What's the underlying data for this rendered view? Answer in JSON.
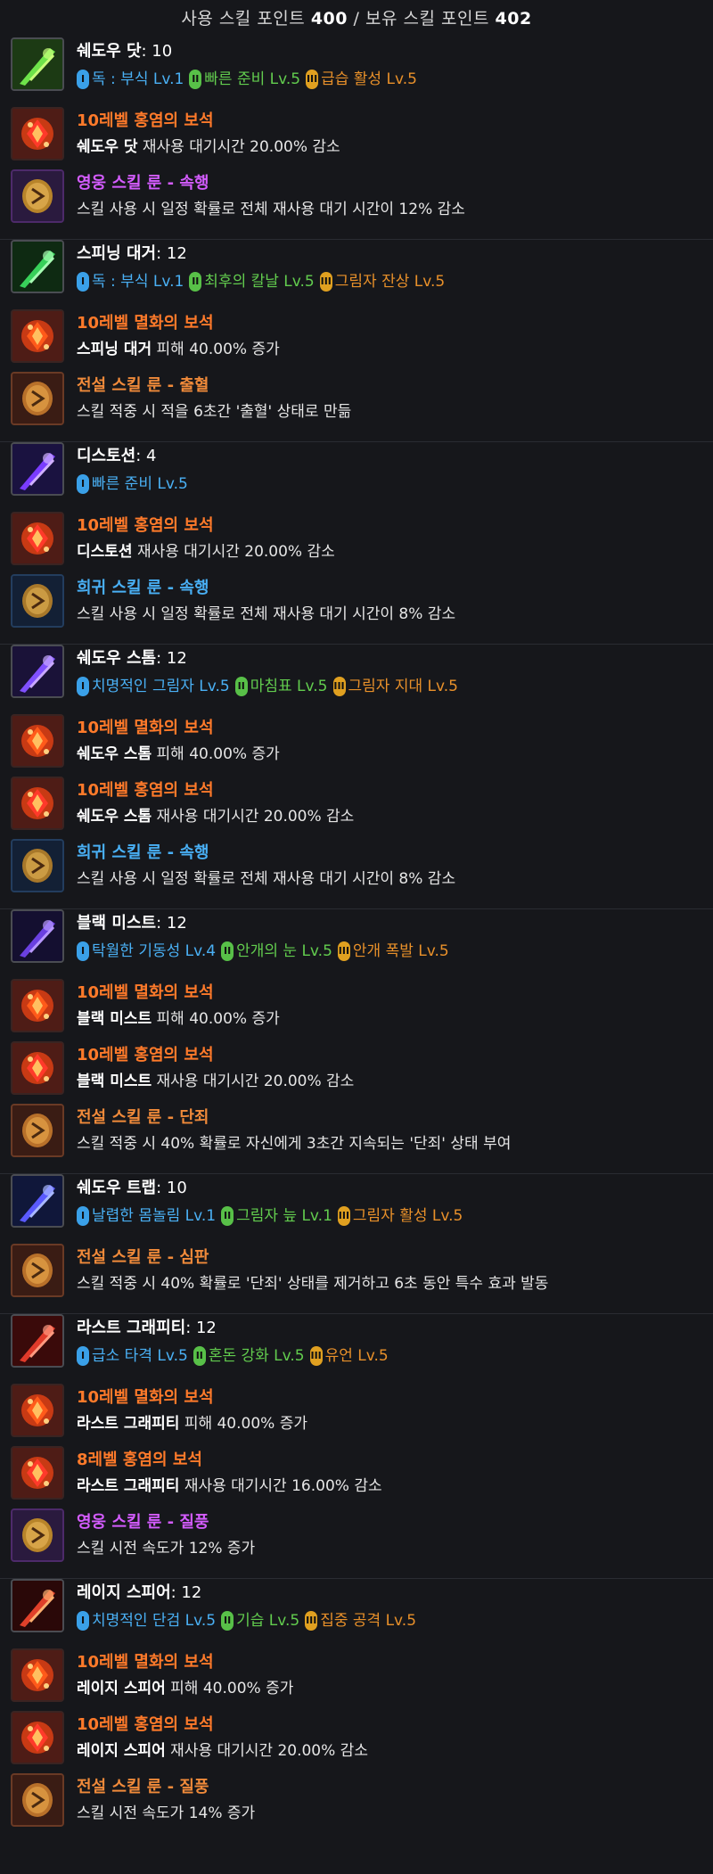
{
  "header": {
    "used_label": "사용 스킬 포인트",
    "used_value": "400",
    "separator": "/",
    "owned_label": "보유 스킬 포인트",
    "owned_value": "402"
  },
  "colors": {
    "gem_title": "#ff7a2a",
    "hero_rune": "#d45cff",
    "rare_rune": "#49b0f5",
    "legend_rune": "#f08a3a",
    "tripod_1": "#4ab0f4",
    "tripod_2": "#62cc4e",
    "tripod_3": "#e8902a"
  },
  "skills": [
    {
      "name": "쉐도우 닷",
      "level": ": 10",
      "icon": "shadow-dot-icon",
      "tripods": [
        "독 : 부식 Lv.1",
        "빠른 준비 Lv.5",
        "급습 활성 Lv.5"
      ],
      "items": [
        {
          "kind": "gem-fire",
          "title": "10레벨 홍염의 보석",
          "skill": "쉐도우 닷",
          "desc": "재사용 대기시간 20.00% 감소"
        },
        {
          "kind": "rune-hero",
          "title": "영웅 스킬 룬 - 속행",
          "skill": "",
          "desc": "스킬 사용 시 일정 확률로 전체 재사용 대기 시간이 12% 감소"
        }
      ]
    },
    {
      "name": "스피닝 대거",
      "level": ": 12",
      "icon": "spinning-dagger-icon",
      "tripods": [
        "독 : 부식 Lv.1",
        "최후의 칼날 Lv.5",
        "그림자 잔상 Lv.5"
      ],
      "items": [
        {
          "kind": "gem-dmg",
          "title": "10레벨 멸화의 보석",
          "skill": "스피닝 대거",
          "desc": "피해 40.00% 증가"
        },
        {
          "kind": "rune-legend",
          "title": "전설 스킬 룬 - 출혈",
          "skill": "",
          "desc": "스킬 적중 시 적을 6초간 '출혈' 상태로 만듦"
        }
      ]
    },
    {
      "name": "디스토션",
      "level": ": 4",
      "icon": "distortion-icon",
      "tripods": [
        "빠른 준비 Lv.5"
      ],
      "items": [
        {
          "kind": "gem-fire",
          "title": "10레벨 홍염의 보석",
          "skill": "디스토션",
          "desc": "재사용 대기시간 20.00% 감소"
        },
        {
          "kind": "rune-rare",
          "title": "희귀 스킬 룬 - 속행",
          "skill": "",
          "desc": "스킬 사용 시 일정 확률로 전체 재사용 대기 시간이 8% 감소"
        }
      ]
    },
    {
      "name": "쉐도우 스톰",
      "level": ": 12",
      "icon": "shadow-storm-icon",
      "tripods": [
        "치명적인 그림자 Lv.5",
        "마침표 Lv.5",
        "그림자 지대 Lv.5"
      ],
      "items": [
        {
          "kind": "gem-dmg",
          "title": "10레벨 멸화의 보석",
          "skill": "쉐도우 스톰",
          "desc": "피해 40.00% 증가"
        },
        {
          "kind": "gem-fire",
          "title": "10레벨 홍염의 보석",
          "skill": "쉐도우 스톰",
          "desc": "재사용 대기시간 20.00% 감소"
        },
        {
          "kind": "rune-rare",
          "title": "희귀 스킬 룬 - 속행",
          "skill": "",
          "desc": "스킬 사용 시 일정 확률로 전체 재사용 대기 시간이 8% 감소"
        }
      ]
    },
    {
      "name": "블랙 미스트",
      "level": ": 12",
      "icon": "black-mist-icon",
      "tripods": [
        "탁월한 기동성 Lv.4",
        "안개의 눈 Lv.5",
        "안개 폭발 Lv.5"
      ],
      "items": [
        {
          "kind": "gem-dmg",
          "title": "10레벨 멸화의 보석",
          "skill": "블랙 미스트",
          "desc": "피해 40.00% 증가"
        },
        {
          "kind": "gem-fire",
          "title": "10레벨 홍염의 보석",
          "skill": "블랙 미스트",
          "desc": "재사용 대기시간 20.00% 감소"
        },
        {
          "kind": "rune-legend",
          "title": "전설 스킬 룬 - 단죄",
          "skill": "",
          "desc": "스킬 적중 시 40% 확률로 자신에게 3초간 지속되는 '단죄' 상태 부여"
        }
      ]
    },
    {
      "name": "쉐도우 트랩",
      "level": ": 10",
      "icon": "shadow-trap-icon",
      "tripods": [
        "날렵한 몸놀림 Lv.1",
        "그림자 늪 Lv.1",
        "그림자 활성 Lv.5"
      ],
      "items": [
        {
          "kind": "rune-legend",
          "title": "전설 스킬 룬 - 심판",
          "skill": "",
          "desc": "스킬 적중 시 40% 확률로 '단죄' 상태를 제거하고 6초 동안 특수 효과 발동"
        }
      ]
    },
    {
      "name": "라스트 그래피티",
      "level": ": 12",
      "icon": "last-graffiti-icon",
      "tripods": [
        "급소 타격 Lv.5",
        "혼돈 강화 Lv.5",
        "유언 Lv.5"
      ],
      "items": [
        {
          "kind": "gem-dmg",
          "title": "10레벨 멸화의 보석",
          "skill": "라스트 그래피티",
          "desc": "피해 40.00% 증가"
        },
        {
          "kind": "gem-fire",
          "title": "8레벨 홍염의 보석",
          "skill": "라스트 그래피티",
          "desc": "재사용 대기시간 16.00% 감소"
        },
        {
          "kind": "rune-hero",
          "title": "영웅 스킬 룬 - 질풍",
          "skill": "",
          "desc": "스킬 시전 속도가 12% 증가"
        }
      ]
    },
    {
      "name": "레이지 스피어",
      "level": ": 12",
      "icon": "rage-spear-icon",
      "tripods": [
        "치명적인 단검 Lv.5",
        "기습 Lv.5",
        "집중 공격 Lv.5"
      ],
      "items": [
        {
          "kind": "gem-dmg",
          "title": "10레벨 멸화의 보석",
          "skill": "레이지 스피어",
          "desc": "피해 40.00% 증가"
        },
        {
          "kind": "gem-fire",
          "title": "10레벨 홍염의 보석",
          "skill": "레이지 스피어",
          "desc": "재사용 대기시간 20.00% 감소"
        },
        {
          "kind": "rune-legend",
          "title": "전설 스킬 룬 - 질풍",
          "skill": "",
          "desc": "스킬 시전 속도가 14% 증가"
        }
      ]
    }
  ]
}
